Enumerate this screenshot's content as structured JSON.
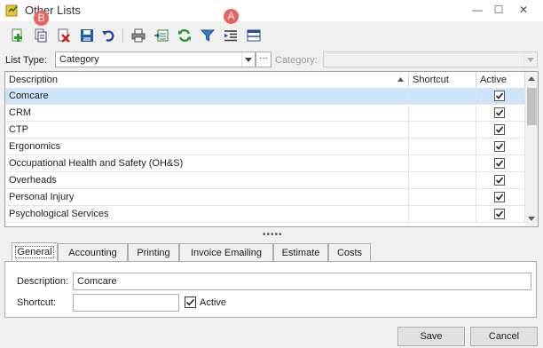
{
  "window": {
    "title": "Other Lists",
    "minimize_glyph": "—",
    "maximize_glyph": "☐",
    "close_glyph": "✕"
  },
  "markers": {
    "a": "A",
    "b": "B"
  },
  "toolbar": {
    "icons": [
      "add-icon",
      "copy-icon",
      "delete-icon",
      "save-icon",
      "undo-icon",
      "print-icon",
      "export-icon",
      "refresh-icon",
      "filter-icon",
      "indent-icon",
      "layout-icon"
    ]
  },
  "filter": {
    "list_type_label": "List Type:",
    "list_type_value": "Category",
    "more_glyph": "···",
    "category_label": "Category:",
    "category_value": ""
  },
  "grid": {
    "columns": [
      "Description",
      "Shortcut",
      "Active"
    ],
    "rows": [
      {
        "description": "Comcare",
        "shortcut": "",
        "active": true
      },
      {
        "description": "CRM",
        "shortcut": "",
        "active": true
      },
      {
        "description": "CTP",
        "shortcut": "",
        "active": true
      },
      {
        "description": "Ergonomics",
        "shortcut": "",
        "active": true
      },
      {
        "description": "Occupational Health and Safety (OH&S)",
        "shortcut": "",
        "active": true
      },
      {
        "description": "Overheads",
        "shortcut": "",
        "active": true
      },
      {
        "description": "Personal Injury",
        "shortcut": "",
        "active": true
      },
      {
        "description": "Psychological Services",
        "shortcut": "",
        "active": true
      }
    ],
    "selected_index": 0,
    "splitter_glyph": "•••••"
  },
  "tabs": [
    "General",
    "Accounting",
    "Printing",
    "Invoice Emailing",
    "Estimate",
    "Costs"
  ],
  "active_tab": "General",
  "form": {
    "description_label": "Description:",
    "description_value": "Comcare",
    "shortcut_label": "Shortcut:",
    "shortcut_value": "",
    "active_label": "Active",
    "active_checked": true
  },
  "footer": {
    "save_label": "Save",
    "cancel_label": "Cancel"
  },
  "colors": {
    "selected_row": "#cde3f7",
    "marker": "#e8625e"
  }
}
